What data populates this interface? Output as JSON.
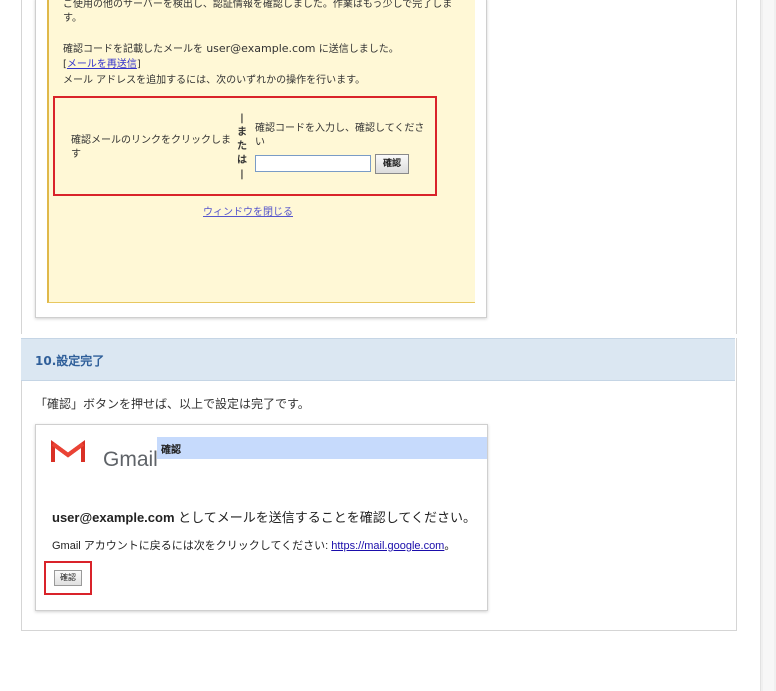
{
  "step9": {
    "line1": "ご使用の他のサーバーを検出し、認証情報を確認しました。作業はもう少しで完了しま",
    "line2": "す。",
    "sent_prefix": "確認コードを記載したメールを ",
    "sent_email": "user@example.com",
    "sent_suffix": " に送信しました。",
    "resend_open": "[",
    "resend_link": "メールを再送信",
    "resend_close": "]",
    "instruction": "メール アドレスを追加するには、次のいずれかの操作を行います。",
    "option_link": "確認メールのリンクをクリックします",
    "or_text": [
      "|",
      "ま",
      "た",
      "は",
      "|"
    ],
    "option_code": "確認コードを入力し、確認してください",
    "confirm_button": "確認",
    "close_window": "ウィンドウを閉じる"
  },
  "step10": {
    "header": "10.設定完了",
    "description": "「確認」ボタンを押せば、以上で設定は完了です。",
    "gmail": {
      "brand": "Gmail",
      "window_title": "確認",
      "email": "user@example.com",
      "line1_suffix": " としてメールを送信することを確認してください。",
      "line2_prefix": "Gmail アカウントに戻るには次をクリックしてください: ",
      "link": "https://mail.google.com",
      "line2_suffix": "。",
      "confirm_button": "確認"
    }
  },
  "colors": {
    "header_bg": "#dbe7f2",
    "header_text": "#2f5f9a",
    "highlight_red": "#d9232a",
    "panel_yellow": "#fff8d6"
  },
  "icons": {
    "gmail_logo": "gmail-m-icon"
  }
}
